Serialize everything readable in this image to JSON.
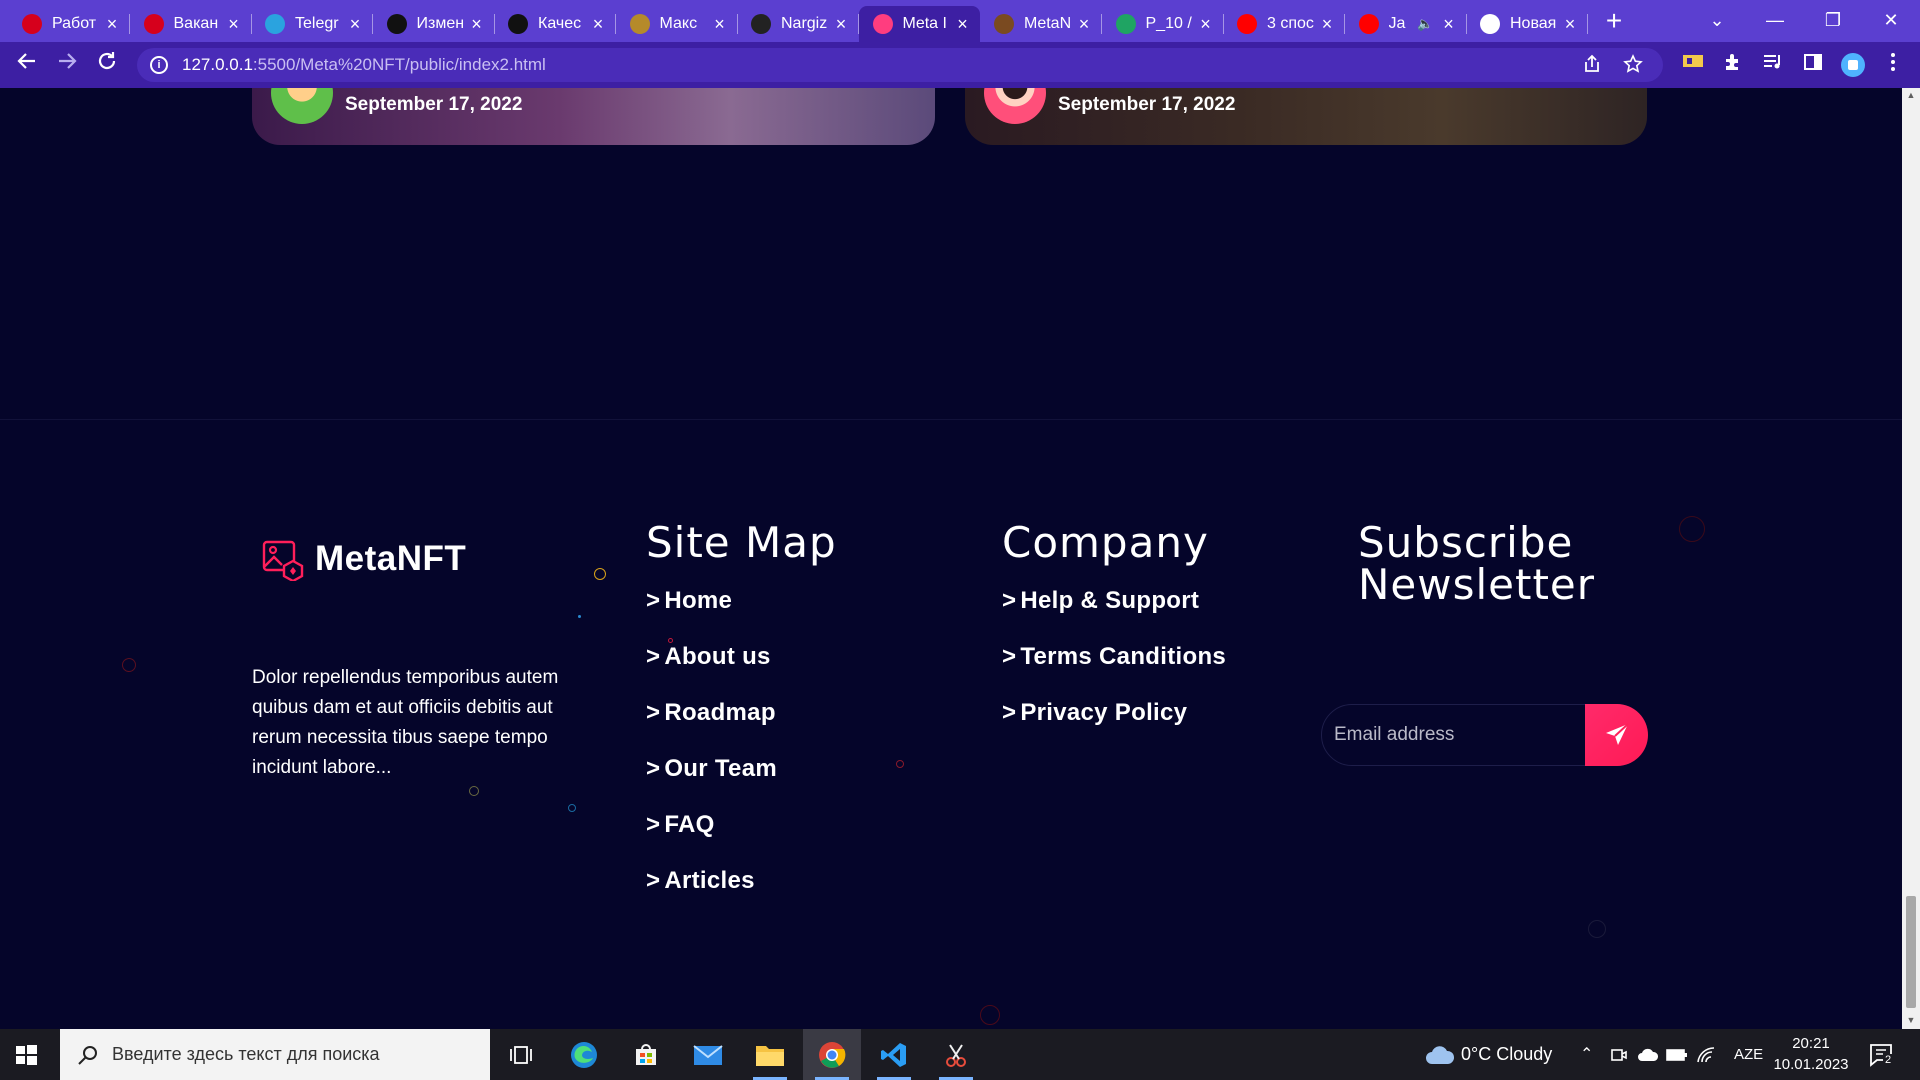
{
  "browser": {
    "tabs": [
      {
        "title": "Работ",
        "favicon": "hh-icon",
        "color": "#d6001c",
        "active": false
      },
      {
        "title": "Вакан",
        "favicon": "hh-icon",
        "color": "#d6001c",
        "active": false
      },
      {
        "title": "Telegr",
        "favicon": "telegram-icon",
        "color": "#2aa3df",
        "active": false
      },
      {
        "title": "Измен",
        "favicon": "kinopoisk-icon",
        "color": "#111111",
        "active": false
      },
      {
        "title": "Качес",
        "favicon": "kinopoisk-icon",
        "color": "#111111",
        "active": false
      },
      {
        "title": "Макс",
        "favicon": "leaf-icon",
        "color": "#b58a2a",
        "active": false
      },
      {
        "title": "Nargiz",
        "favicon": "github-icon",
        "color": "#222222",
        "active": false
      },
      {
        "title": "Meta I",
        "favicon": "metanft-icon",
        "color": "#ff3d7f",
        "active": true
      },
      {
        "title": "MetaN",
        "favicon": "figure-icon",
        "color": "#7a4a20",
        "active": false
      },
      {
        "title": "P_10 /",
        "favicon": "google-drive-icon",
        "color": "#1fa463",
        "active": false
      },
      {
        "title": "3 спос",
        "favicon": "youtube-icon",
        "color": "#ff0000",
        "active": false
      },
      {
        "title": "Ja",
        "favicon": "youtube-icon",
        "color": "#ff0000",
        "active": false,
        "audio": "🔈"
      },
      {
        "title": "Новая",
        "favicon": "chrome-icon",
        "color": "#ffffff",
        "active": false
      }
    ],
    "new_tab_glyph": "+",
    "tab_close_glyph": "×",
    "url": "127.0.0.1",
    "url_rest": ":5500/Meta%20NFT/public/index2.html",
    "window": {
      "minimize": "—",
      "restore": "❐",
      "close": "✕",
      "tab_search": "⌄"
    }
  },
  "page": {
    "cards": [
      {
        "date": "September 17, 2022"
      },
      {
        "date": "September 17, 2022"
      }
    ],
    "brand": "MetaNFT",
    "about": "Dolor repellendus temporibus autem quibus dam et aut officiis debitis aut rerum necessita tibus saepe tempo incidunt labore...",
    "sitemap": {
      "title": "Site Map",
      "links": [
        "Home",
        "About us",
        "Roadmap",
        "Our Team",
        "FAQ",
        "Articles"
      ]
    },
    "company": {
      "title": "Company",
      "links": [
        "Help & Support",
        "Terms Canditions",
        "Privacy Policy"
      ]
    },
    "newsletter": {
      "title_line1": "Subscribe",
      "title_line2": "Newsletter",
      "placeholder": "Email address"
    },
    "link_prefix": ">",
    "accent": "#ff1f5a"
  },
  "taskbar": {
    "search_placeholder": "Введите здесь текст для поиска",
    "weather": "0°C  Cloudy",
    "language": "AZE",
    "time": "20:21",
    "date": "10.01.2023",
    "notifications": "2"
  }
}
